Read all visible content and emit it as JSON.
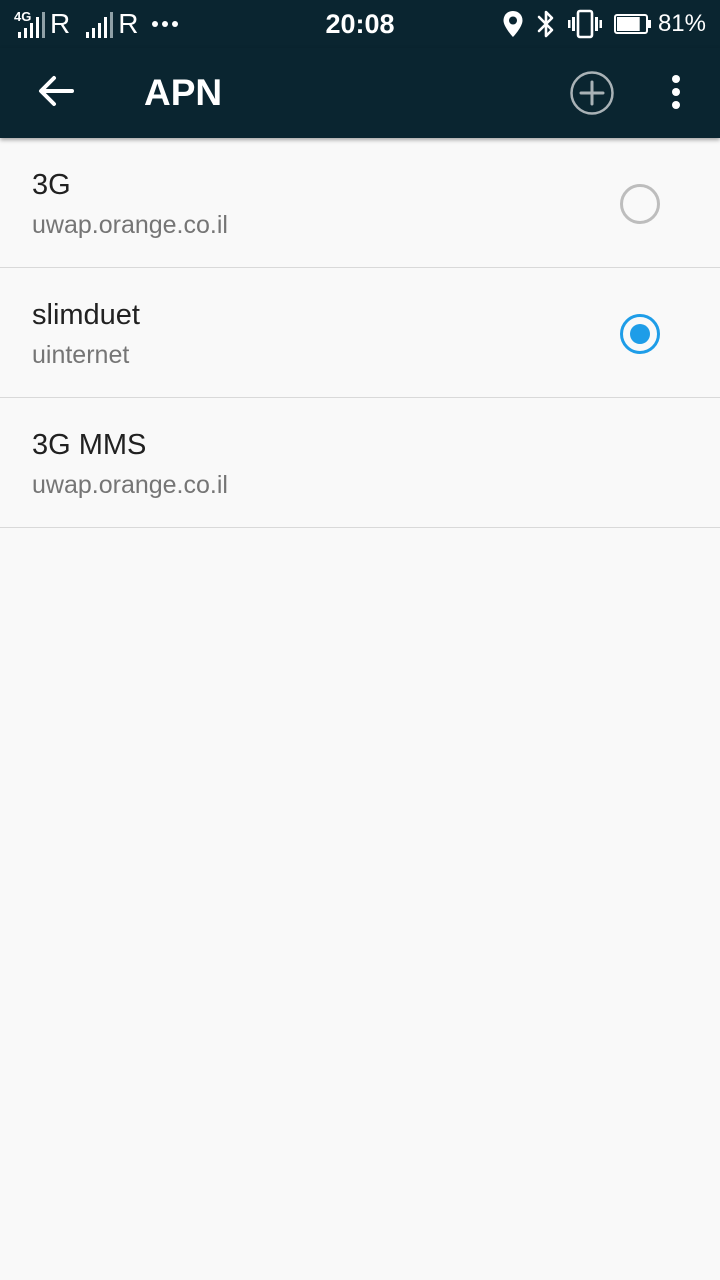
{
  "status_bar": {
    "network_type": "4G",
    "sim1_roaming": "R",
    "sim2_roaming": "R",
    "time": "20:08",
    "battery_percent": "81%",
    "battery_level": 0.81,
    "icons": [
      "signal-icon",
      "signal-icon",
      "more-notifications-icon",
      "location-icon",
      "bluetooth-icon",
      "vibrate-icon",
      "battery-icon"
    ]
  },
  "app_bar": {
    "title": "APN",
    "icons": [
      "back-arrow-icon",
      "add-circle-icon",
      "more-vert-icon"
    ]
  },
  "apn_list": [
    {
      "name": "3G",
      "apn": "uwap.orange.co.il",
      "selectable": true,
      "selected": false
    },
    {
      "name": "slimduet",
      "apn": "uinternet",
      "selectable": true,
      "selected": true
    },
    {
      "name": "3G MMS",
      "apn": "uwap.orange.co.il",
      "selectable": false,
      "selected": false
    }
  ],
  "colors": {
    "app_bar": "#0a2530",
    "background": "#f9f9f9",
    "accent": "#1e9de8",
    "primary_text": "#212121",
    "secondary_text": "#757575",
    "divider": "#d9d9d9",
    "radio_unchecked": "#bdbdbd"
  }
}
